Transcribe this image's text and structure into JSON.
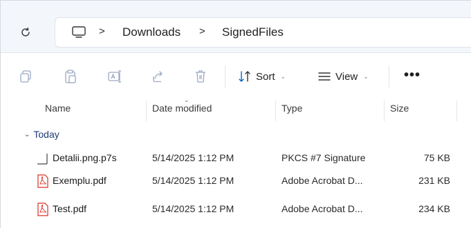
{
  "address_bar": {
    "breadcrumbs": [
      "Downloads",
      "SignedFiles"
    ],
    "separator": ">"
  },
  "toolbar": {
    "sort_label": "Sort",
    "view_label": "View",
    "more_label": "•••"
  },
  "columns": {
    "name": "Name",
    "date_modified": "Date modified",
    "type": "Type",
    "size": "Size"
  },
  "group": {
    "label": "Today"
  },
  "files": [
    {
      "name": "Detalii.png.p7s",
      "date": "5/14/2025 1:12 PM",
      "type": "PKCS #7 Signature",
      "size": "75 KB",
      "icon": "generic-file-icon"
    },
    {
      "name": "Exemplu.pdf",
      "date": "5/14/2025 1:12 PM",
      "type": "Adobe Acrobat D...",
      "size": "231 KB",
      "icon": "pdf-file-icon"
    },
    {
      "name": "Test.pdf",
      "date": "5/14/2025 1:12 PM",
      "type": "Adobe Acrobat D...",
      "size": "234 KB",
      "icon": "pdf-file-icon"
    }
  ],
  "colors": {
    "accent": "#0067c0",
    "pdf_red": "#d93025",
    "group_text": "#1e3a74"
  }
}
